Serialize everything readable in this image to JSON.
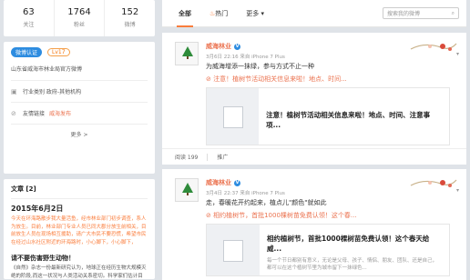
{
  "stats": [
    {
      "num": "63",
      "label": "关注"
    },
    {
      "num": "1764",
      "label": "粉丝"
    },
    {
      "num": "152",
      "label": "微博"
    }
  ],
  "profile": {
    "badge": "微博认证",
    "level": "Lv17",
    "verify": "山东省威海市林业局官方微博",
    "industry": "行业类别 政府-其他机构",
    "link_label": "友情链接",
    "link_value": "威海发布",
    "more": "更多 >"
  },
  "articles": {
    "title": "文章 [2]",
    "date": "2015年6月2日",
    "text": "今天在环海路散步我大量活鱼，经市林业部门初步调查，系人为放生。目前，林业部门专业人员已同大郡分放生前相关，目前放生人员在现场相互援助，请广大市民不要恐慌，希望市民在经过山水社区附近的环海路时，小心脚下，小心脚下，",
    "title2": "请不要伤害野生动物！",
    "text2": "《自然》杂志一份最新研究认为，地球正在经历生物大规模灭绝的阶段,而这一状况与人类活动关系密切。科学家们估计目前1990种哺乳动物、1373种鸟"
  },
  "tabs": [
    {
      "label": "全部"
    },
    {
      "label": "热门"
    },
    {
      "label": "更多 ▾"
    }
  ],
  "search_placeholder": "搜索我的微博",
  "post1": {
    "author": "威海林业",
    "meta": "3月6日 22:16 来自 iPhone 7 Plus",
    "text": "为威海增添一抹绿，参与方式不止一种",
    "link": "注意！植树节活动相关信息来啦！地点、时间...",
    "card_title": "注意！植树节活动相关信息来啦！地点、时间、注意事项...",
    "read": "阅读 199",
    "promote": "推广"
  },
  "post2": {
    "author": "威海林业",
    "meta": "3月4日 22:37 来自 iPhone 7 Plus",
    "text": "走，春暖花开约起来，植点儿\"颜色\"就如此",
    "link": "相约植树节，首批1000棵树苗免费认领！这个春...",
    "card_title": "相约植树节，首批1000棵树苗免费认领！这个春天给威...",
    "card_desc": "每一个节日都别有意义，无论是父母、孩子、情侣、朋友、团队、还是自己，都可以在这个植树节里为城市留下一抹绿色..."
  }
}
